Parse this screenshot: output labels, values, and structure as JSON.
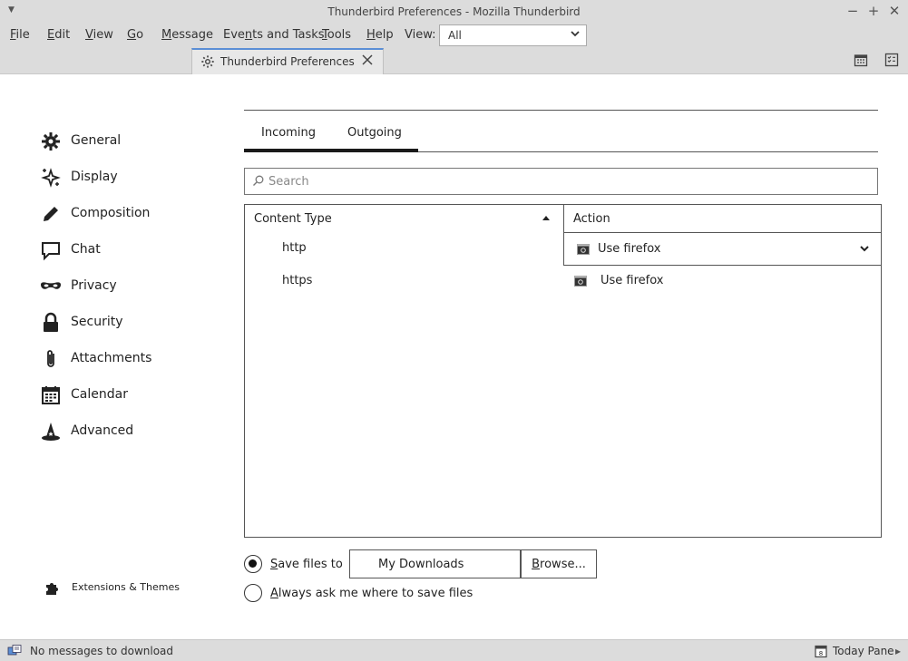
{
  "window": {
    "title": "Thunderbird Preferences - Mozilla Thunderbird",
    "controls": {
      "minimize": "−",
      "maximize": "+",
      "close": "✕"
    }
  },
  "menubar": {
    "items": [
      {
        "label": "File",
        "accel": "F"
      },
      {
        "label": "Edit",
        "accel": "E"
      },
      {
        "label": "View",
        "accel": "V"
      },
      {
        "label": "Go",
        "accel": "G"
      },
      {
        "label": "Message",
        "accel": "M"
      },
      {
        "label": "Events and Tasks",
        "accel": "n"
      },
      {
        "label": "Tools",
        "accel": "T"
      },
      {
        "label": "Help",
        "accel": "H"
      }
    ],
    "view_label": "View:",
    "view_value": "All"
  },
  "tab": {
    "label": "Thunderbird Preferences",
    "close": "✕"
  },
  "sidebar": {
    "items": [
      {
        "label": "General",
        "icon": "gear-icon"
      },
      {
        "label": "Display",
        "icon": "sparkle-icon"
      },
      {
        "label": "Composition",
        "icon": "pencil-icon"
      },
      {
        "label": "Chat",
        "icon": "chat-icon"
      },
      {
        "label": "Privacy",
        "icon": "mask-icon"
      },
      {
        "label": "Security",
        "icon": "lock-icon"
      },
      {
        "label": "Attachments",
        "icon": "paperclip-icon"
      },
      {
        "label": "Calendar",
        "icon": "calendar-icon"
      },
      {
        "label": "Advanced",
        "icon": "wizard-hat-icon"
      }
    ],
    "extensions_label": "Extensions & Themes"
  },
  "content": {
    "tabs": [
      {
        "label": "Incoming"
      },
      {
        "label": "Outgoing"
      }
    ],
    "search_placeholder": "Search",
    "grid": {
      "columns": {
        "content_type": "Content Type",
        "action": "Action"
      },
      "rows": [
        {
          "content_type": "http",
          "action": "Use firefox"
        },
        {
          "content_type": "https",
          "action": "Use firefox"
        }
      ]
    },
    "save": {
      "option_save": "Save files to",
      "save_accel": "S",
      "save_rest": "ave files to",
      "folder": "My Downloads",
      "browse_accel": "B",
      "browse_rest": "rowse...",
      "option_ask_accel": "A",
      "option_ask_rest": "lways ask me where to save files",
      "selected": "save"
    }
  },
  "statusbar": {
    "status": "No messages to download",
    "today_pane": "Today Pane",
    "calendar_day": "8"
  }
}
